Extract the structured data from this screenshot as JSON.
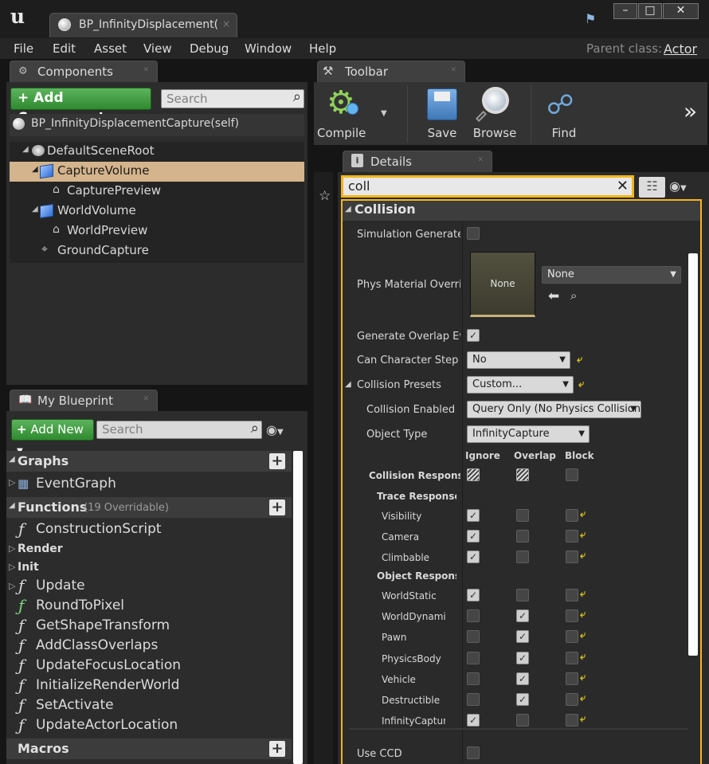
{
  "window": {
    "tab_title": "BP_InfinityDisplacement(",
    "tab_close": "×",
    "minimize": "–",
    "maximize": "□",
    "close": "✕"
  },
  "menu": {
    "items": [
      "File",
      "Edit",
      "Asset",
      "View",
      "Debug",
      "Window",
      "Help"
    ],
    "parent_class_label": "Parent class:",
    "parent_class_value": "Actor"
  },
  "components": {
    "tab_label": "Components",
    "add_button": "Add Component",
    "search_placeholder": "Search",
    "self_label": "BP_InfinityDisplacementCapture(self)",
    "tree": [
      {
        "label": "DefaultSceneRoot",
        "icon": "scene-root-icon"
      },
      {
        "label": "CaptureVolume",
        "icon": "cube-icon",
        "selected": true
      },
      {
        "label": "CapturePreview",
        "icon": "preview-icon"
      },
      {
        "label": "WorldVolume",
        "icon": "cube-icon"
      },
      {
        "label": "WorldPreview",
        "icon": "preview-icon"
      },
      {
        "label": "GroundCapture",
        "icon": "capture-icon"
      }
    ]
  },
  "my_blueprint": {
    "tab_label": "My Blueprint",
    "add_button": "Add New",
    "search_placeholder": "Search",
    "graphs_label": "Graphs",
    "event_graph": "EventGraph",
    "functions_label": "Functions",
    "functions_count": "(19 Overridable)",
    "functions": [
      "ConstructionScript",
      "Render",
      "Init",
      "Update",
      "RoundToPixel",
      "GetShapeTransform",
      "AddClassOverlaps",
      "UpdateFocusLocation",
      "InitializeRenderWorld",
      "SetActivate",
      "UpdateActorLocation"
    ],
    "macros_label": "Macros"
  },
  "toolbar": {
    "tab_label": "Toolbar",
    "compile": "Compile",
    "save": "Save",
    "browse": "Browse",
    "find": "Find"
  },
  "details": {
    "tab_label": "Details",
    "search_value": "coll",
    "category": "Collision",
    "sim_generates_hit": "Simulation Generates H",
    "phys_material_override": "Phys Material Override",
    "phys_thumb": "None",
    "phys_combo": "None",
    "generate_overlap": "Generate Overlap Even",
    "can_step_up": "Can Character Step Up",
    "can_step_up_value": "No",
    "presets": "Collision Presets",
    "presets_value": "Custom...",
    "enabled": "Collision Enabled",
    "enabled_value": "Query Only (No Physics Collision)",
    "object_type": "Object Type",
    "object_type_value": "InfinityCapture",
    "col_ignore": "Ignore",
    "col_overlap": "Overlap",
    "col_block": "Block",
    "responses_label": "Collision Responses",
    "trace_responses": "Trace Response",
    "trace": [
      {
        "name": "Visibility",
        "response": "ignore"
      },
      {
        "name": "Camera",
        "response": "ignore"
      },
      {
        "name": "Climbable",
        "response": "ignore"
      }
    ],
    "object_responses": "Object Respons",
    "objects": [
      {
        "name": "WorldStatic",
        "response": "ignore"
      },
      {
        "name": "WorldDynami",
        "response": "overlap"
      },
      {
        "name": "Pawn",
        "response": "overlap"
      },
      {
        "name": "PhysicsBody",
        "response": "overlap"
      },
      {
        "name": "Vehicle",
        "response": "overlap"
      },
      {
        "name": "Destructible",
        "response": "overlap"
      },
      {
        "name": "InfinityCaptur",
        "response": "ignore"
      }
    ],
    "use_ccd": "Use CCD"
  },
  "colors": {
    "selected_row": "#d4b48c",
    "accent_yellow": "#f2b51e",
    "green_button": "#3a9a3a"
  }
}
